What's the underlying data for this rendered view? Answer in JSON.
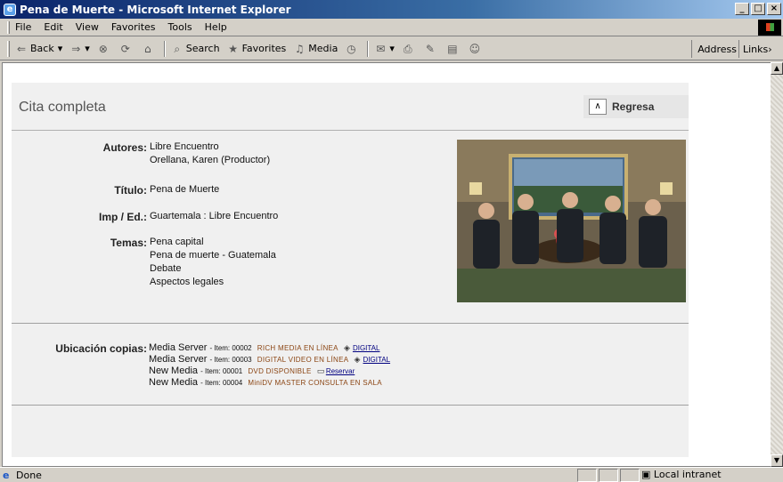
{
  "window": {
    "title": "Pena de Muerte - Microsoft Internet Explorer"
  },
  "menu": [
    "File",
    "Edit",
    "View",
    "Favorites",
    "Tools",
    "Help"
  ],
  "toolbar": {
    "back": "Back",
    "search": "Search",
    "favorites": "Favorites",
    "media": "Media",
    "address": "Address",
    "links": "Links"
  },
  "page": {
    "title": "Cita completa",
    "back_button": "Regresa",
    "fields": {
      "autores_label": "Autores:",
      "autores": [
        "Libre Encuentro",
        "Orellana, Karen (Productor)"
      ],
      "titulo_label": "Título:",
      "titulo": "Pena de Muerte",
      "imp_label": "Imp / Ed.:",
      "imp": "Guartemala : Libre Encuentro",
      "temas_label": "Temas:",
      "temas": [
        "Pena capital",
        "Pena de muerte - Guatemala",
        "Debate",
        "Aspectos legales"
      ]
    },
    "ubicacion_label": "Ubicación copias:",
    "copies": [
      {
        "source": "Media Server",
        "item": "- Item: 00002",
        "status": "RICH MEDIA  EN LÍNEA",
        "link": "DIGITAL"
      },
      {
        "source": "Media Server",
        "item": "- Item: 00003",
        "status": "DIGITAL VIDEO  EN LÍNEA",
        "link": "DIGITAL"
      },
      {
        "source": "New Media",
        "item": "- Item: 00001",
        "status": "DVD  DISPONIBLE",
        "link": "Reservar"
      },
      {
        "source": "New Media",
        "item": "- Item: 00004",
        "status": "MiniDV MASTER  CONSULTA EN SALA",
        "link": ""
      }
    ]
  },
  "status": {
    "text": "Done",
    "zone": "Local intranet"
  },
  "colors": {
    "status_text": "#8b4513",
    "link": "#000080",
    "titlebar": "#0a246a"
  }
}
